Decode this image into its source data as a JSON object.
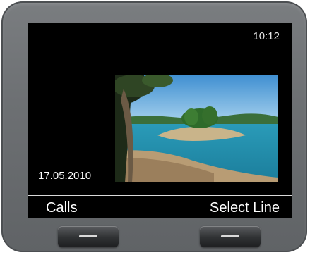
{
  "status": {
    "time": "10:12"
  },
  "home": {
    "date": "17.05.2010"
  },
  "softkeys": {
    "left_label": "Calls",
    "right_label": "Select Line"
  },
  "icons": {
    "left_button": "dash-icon",
    "right_button": "dash-icon"
  },
  "colors": {
    "screen_bg": "#000000",
    "device_bezel": "#6d7073",
    "text": "#ffffff"
  }
}
